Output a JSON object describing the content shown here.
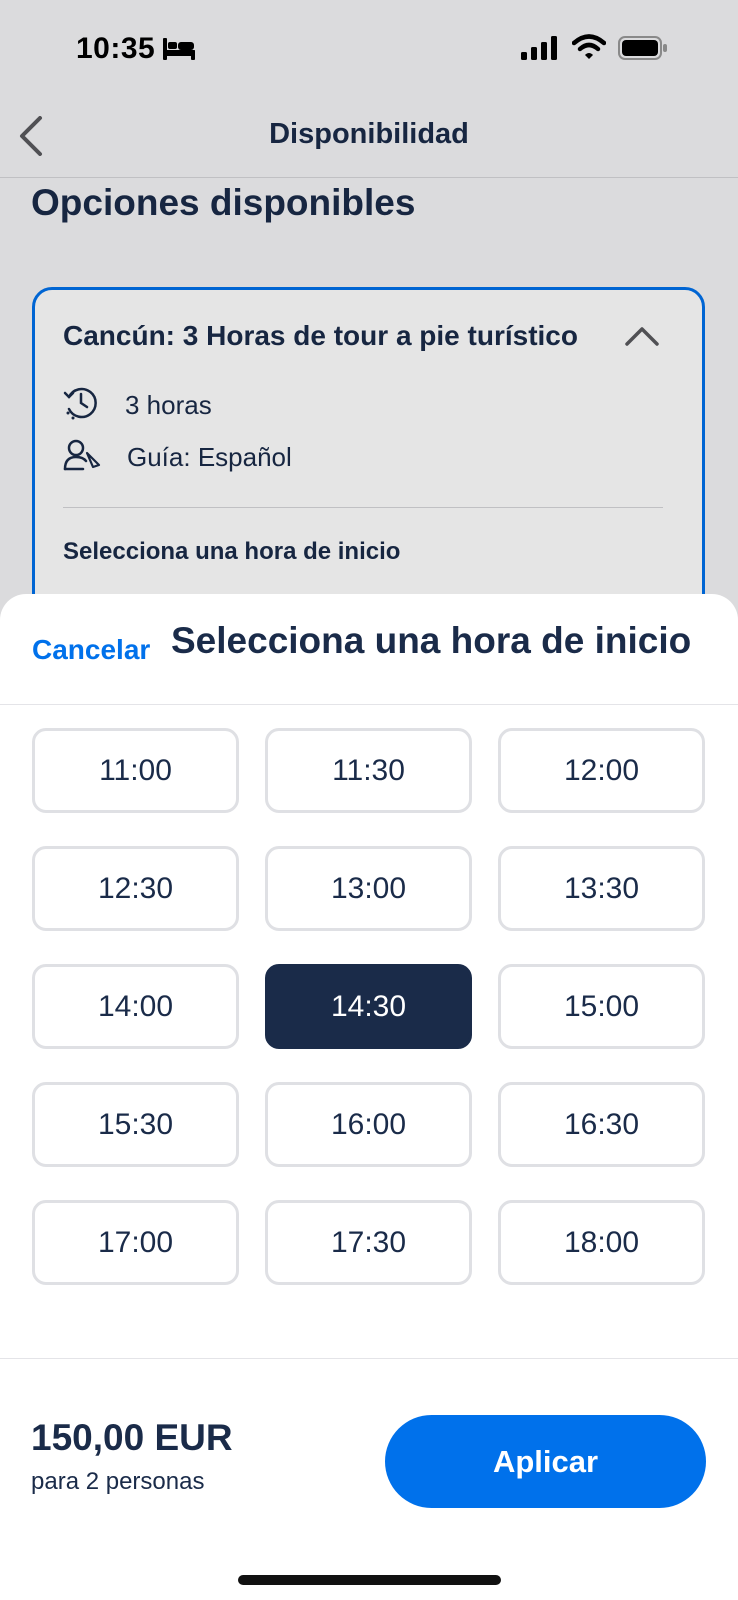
{
  "status_bar": {
    "time": "10:35",
    "icons": [
      "bed-icon",
      "signal-icon",
      "wifi-icon",
      "battery-icon"
    ]
  },
  "nav": {
    "back_icon": "chevron-left-icon",
    "title": "Disponibilidad"
  },
  "background": {
    "section_title": "Opciones disponibles",
    "option": {
      "title": "Cancún: 3 Horas de tour a pie turístico",
      "duration": "3 horas",
      "guide": "Guía: Español",
      "subheading": "Selecciona una hora de inicio"
    }
  },
  "sheet": {
    "cancel_label": "Cancelar",
    "title": "Selecciona una hora de inicio",
    "time_slots": [
      {
        "label": "11:00",
        "selected": false
      },
      {
        "label": "11:30",
        "selected": false
      },
      {
        "label": "12:00",
        "selected": false
      },
      {
        "label": "12:30",
        "selected": false
      },
      {
        "label": "13:00",
        "selected": false
      },
      {
        "label": "13:30",
        "selected": false
      },
      {
        "label": "14:00",
        "selected": false
      },
      {
        "label": "14:30",
        "selected": true
      },
      {
        "label": "15:00",
        "selected": false
      },
      {
        "label": "15:30",
        "selected": false
      },
      {
        "label": "16:00",
        "selected": false
      },
      {
        "label": "16:30",
        "selected": false
      },
      {
        "label": "17:00",
        "selected": false
      },
      {
        "label": "17:30",
        "selected": false
      },
      {
        "label": "18:00",
        "selected": false
      }
    ]
  },
  "footer": {
    "price": "150,00 EUR",
    "price_note": "para 2 personas",
    "apply_label": "Aplicar"
  },
  "colors": {
    "accent": "#0071eb",
    "text_dark": "#1a2b49",
    "selected_bg": "#1a2b49",
    "slot_border": "#dfe0e4"
  }
}
